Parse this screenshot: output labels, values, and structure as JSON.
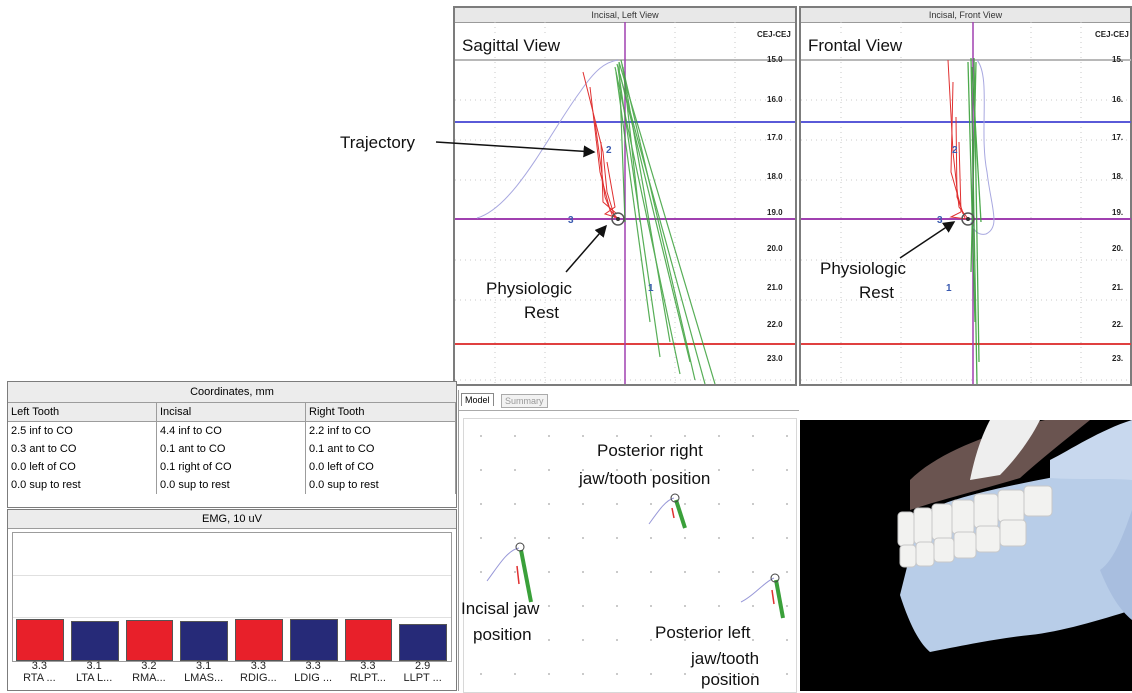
{
  "sagittal": {
    "window_title": "Incisal, Left View",
    "view_label": "Sagittal View",
    "corner_label": "CEJ-CEJ",
    "ticks": [
      "15.0",
      "16.0",
      "17.0",
      "18.0",
      "19.0",
      "20.0",
      "21.0",
      "22.0",
      "23.0"
    ],
    "marker_upper": "2",
    "marker_left": "3",
    "marker_lower": "1"
  },
  "frontal": {
    "window_title": "Incisal, Front View",
    "view_label": "Frontal View",
    "corner_label": "CEJ-CEJ",
    "ticks": [
      "15.",
      "16.",
      "17.",
      "18.",
      "19.",
      "20.",
      "21.",
      "22.",
      "23."
    ],
    "marker_upper": "2",
    "marker_left": "3",
    "marker_lower": "1"
  },
  "annotations": {
    "trajectory": "Trajectory",
    "rest_sagittal_l1": "Physiologic",
    "rest_sagittal_l2": "Rest",
    "rest_frontal_l1": "Physiologic",
    "rest_frontal_l2": "Rest",
    "posterior_right_l1": "Posterior right",
    "posterior_right_l2": "jaw/tooth position",
    "incisal_l1": "Incisal jaw",
    "incisal_l2": "position",
    "posterior_left_l1": "Posterior left",
    "posterior_left_l2": "jaw/tooth",
    "posterior_left_l3": "position"
  },
  "coordinates": {
    "title": "Coordinates, mm",
    "headers": [
      "Left Tooth",
      "Incisal",
      "Right Tooth"
    ],
    "rows": [
      [
        "2.5 inf to CO",
        "4.4 inf to CO",
        "2.2 inf to CO"
      ],
      [
        "0.3 ant to CO",
        "0.1 ant to CO",
        "0.1 ant to CO"
      ],
      [
        "0.0 left of CO",
        "0.1 right of CO",
        "0.0 left of CO"
      ],
      [
        "0.0 sup to rest",
        "0.0 sup to rest",
        "0.0 sup to rest"
      ]
    ]
  },
  "emg": {
    "title": "EMG, 10 uV",
    "colors": {
      "red": "#e8202a",
      "blue": "#262a78"
    },
    "bars": [
      {
        "value": "3.3",
        "label": "RTA ...",
        "color": "red"
      },
      {
        "value": "3.1",
        "label": "LTA L...",
        "color": "blue"
      },
      {
        "value": "3.2",
        "label": "RMA...",
        "color": "red"
      },
      {
        "value": "3.1",
        "label": "LMAS...",
        "color": "blue"
      },
      {
        "value": "3.3",
        "label": "RDIG...",
        "color": "red"
      },
      {
        "value": "3.3",
        "label": "LDIG ...",
        "color": "blue"
      },
      {
        "value": "3.3",
        "label": "RLPT...",
        "color": "red"
      },
      {
        "value": "2.9",
        "label": "LLPT ...",
        "color": "blue"
      }
    ]
  },
  "tabs": {
    "model": "Model",
    "summary": "Summary"
  }
}
